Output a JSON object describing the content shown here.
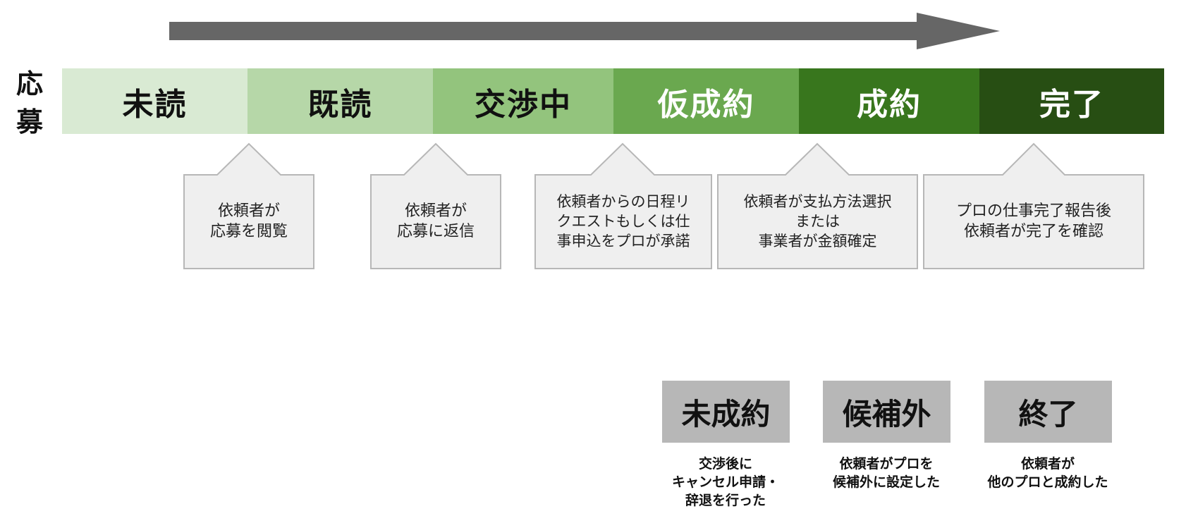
{
  "side_label": [
    "応",
    "募"
  ],
  "stages": [
    {
      "label": "未読",
      "bg": "#d9ead3",
      "fg": "#111111"
    },
    {
      "label": "既読",
      "bg": "#b6d7a8",
      "fg": "#111111"
    },
    {
      "label": "交渉中",
      "bg": "#93c47d",
      "fg": "#111111"
    },
    {
      "label": "仮成約",
      "bg": "#6aa84f",
      "fg": "#ffffff"
    },
    {
      "label": "成約",
      "bg": "#38761d",
      "fg": "#ffffff"
    },
    {
      "label": "完了",
      "bg": "#274e13",
      "fg": "#ffffff"
    }
  ],
  "callouts": [
    {
      "lines": [
        "依頼者が",
        "応募を閲覧"
      ]
    },
    {
      "lines": [
        "依頼者が",
        "応募に返信"
      ]
    },
    {
      "lines": [
        "依頼者からの日程リ",
        "クエストもしくは仕",
        "事申込をプロが承諾"
      ]
    },
    {
      "lines": [
        "依頼者が支払方法選択",
        "または",
        "事業者が金額確定"
      ]
    },
    {
      "lines": [
        "プロの仕事完了報告後",
        "依頼者が完了を確認"
      ]
    }
  ],
  "alternatives": [
    {
      "label": "未成約",
      "desc": [
        "交渉後に",
        "キャンセル申請・",
        "辞退を行った"
      ]
    },
    {
      "label": "候補外",
      "desc": [
        "依頼者がプロを",
        "候補外に設定した"
      ]
    },
    {
      "label": "終了",
      "desc": [
        "依頼者が",
        "他のプロと成約した"
      ]
    }
  ],
  "colors": {
    "arrow": "#666666",
    "callout_fill": "#efefef",
    "callout_stroke": "#b7b7b7",
    "alt_box_fill": "#b7b7b7"
  }
}
